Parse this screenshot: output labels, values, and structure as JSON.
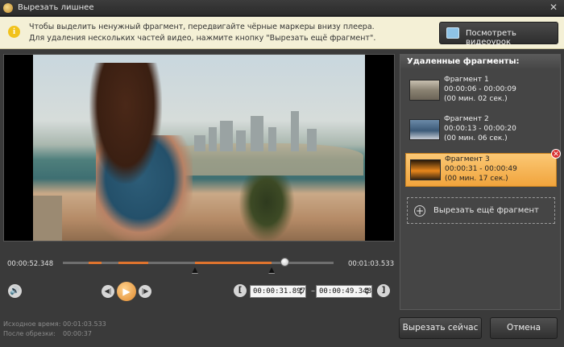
{
  "window": {
    "title": "Вырезать лишнее",
    "close_glyph": "✕"
  },
  "info": {
    "line1": "Чтобы выделить ненужный фрагмент, передвигайте чёрные маркеры внизу плеера.",
    "line2": "Для удаления нескольких частей видео, нажмите кнопку \"Вырезать ещё фрагмент\".",
    "tutorial_button": "Посмотреть видеоурок"
  },
  "player": {
    "current_time": "00:00:52.348",
    "total_time": "00:01:03.533",
    "playhead_fraction": 0.82,
    "cut_segments": [
      {
        "start": 6,
        "end": 9
      },
      {
        "start": 13,
        "end": 20
      },
      {
        "start": 31,
        "end": 49
      }
    ],
    "selection_start": "00:00:31.897",
    "selection_end": "00:00:49.348",
    "range_separator": "–",
    "duration_seconds": 63.533
  },
  "panel": {
    "title": "Удаленные фрагменты:",
    "fragments": [
      {
        "name": "Фрагмент 1",
        "range": "00:00:06 - 00:00:09",
        "duration": "(00 мин. 02 сек.)",
        "active": false
      },
      {
        "name": "Фрагмент 2",
        "range": "00:00:13 - 00:00:20",
        "duration": "(00 мин. 06 сек.)",
        "active": false
      },
      {
        "name": "Фрагмент 3",
        "range": "00:00:31 - 00:00:49",
        "duration": "(00 мин. 17 сек.)",
        "active": true
      }
    ],
    "add_button": "Вырезать ещё фрагмент"
  },
  "status": {
    "original_label": "Исходное время:",
    "original_value": "00:01:03.533",
    "after_label": "После обрезки:",
    "after_value": "00:00:37"
  },
  "actions": {
    "cut_now": "Вырезать сейчас",
    "cancel": "Отмена"
  },
  "colors": {
    "accent": "#e0742e",
    "active_fragment": "#f1a43c",
    "info_background": "#f4f0d6"
  }
}
